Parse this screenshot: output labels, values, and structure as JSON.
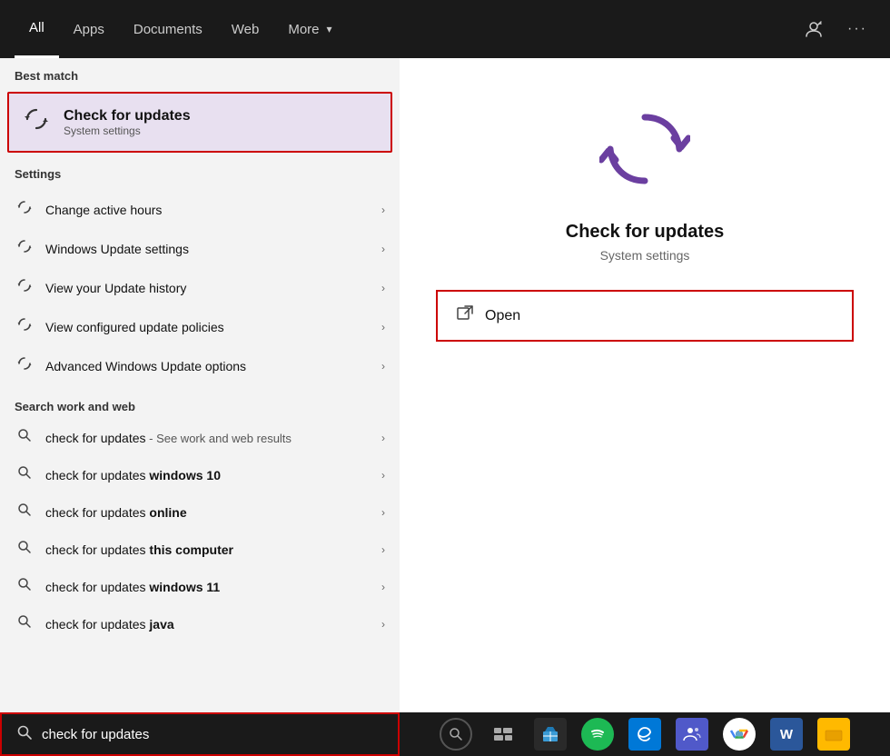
{
  "nav": {
    "tabs": [
      {
        "label": "All",
        "active": true
      },
      {
        "label": "Apps"
      },
      {
        "label": "Documents"
      },
      {
        "label": "Web"
      },
      {
        "label": "More",
        "has_arrow": true
      }
    ],
    "right_icons": [
      "person-icon",
      "ellipsis-icon"
    ]
  },
  "left": {
    "best_match_label": "Best match",
    "best_match": {
      "title": "Check for updates",
      "subtitle": "System settings"
    },
    "settings_label": "Settings",
    "settings_items": [
      {
        "label": "Change active hours"
      },
      {
        "label": "Windows Update settings"
      },
      {
        "label": "View your Update history"
      },
      {
        "label": "View configured update policies"
      },
      {
        "label": "Advanced Windows Update options"
      }
    ],
    "web_label": "Search work and web",
    "web_items": [
      {
        "text_normal": "check for updates",
        "text_suffix": " - See work and web results",
        "text_bold": ""
      },
      {
        "text_normal": "check for updates ",
        "text_bold": "windows 10",
        "text_suffix": ""
      },
      {
        "text_normal": "check for updates ",
        "text_bold": "online",
        "text_suffix": ""
      },
      {
        "text_normal": "check for updates ",
        "text_bold": "this computer",
        "text_suffix": ""
      },
      {
        "text_normal": "check for updates ",
        "text_bold": "windows 11",
        "text_suffix": ""
      },
      {
        "text_normal": "check for updates ",
        "text_bold": "java",
        "text_suffix": ""
      }
    ]
  },
  "right": {
    "title": "Check for updates",
    "subtitle": "System settings",
    "open_label": "Open"
  },
  "search_bar": {
    "value": "check for updates",
    "placeholder": "check for updates"
  }
}
